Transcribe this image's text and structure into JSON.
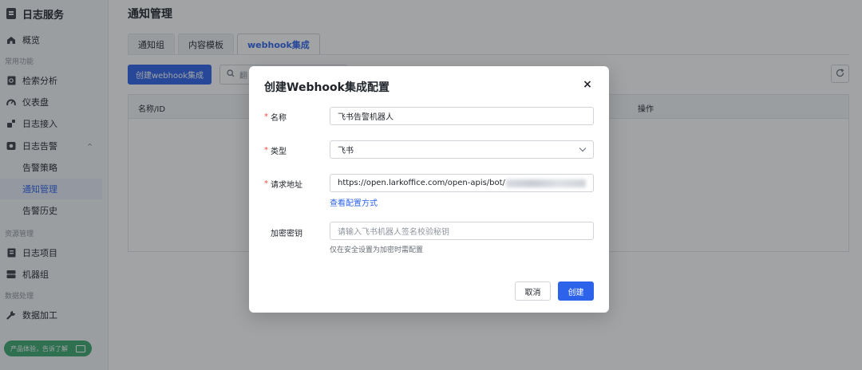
{
  "sidebar": {
    "brand": "日志服务",
    "overview": "概览",
    "section_common": "常用功能",
    "search_analysis": "检索分析",
    "dashboard": "仪表盘",
    "log_access": "日志接入",
    "log_alert": "日志告警",
    "alert_policy": "告警策略",
    "notify_manage": "通知管理",
    "alert_history": "告警历史",
    "section_resource": "资源管理",
    "log_project": "日志项目",
    "machine_group": "机器组",
    "section_data": "数据处理",
    "data_process": "数据加工",
    "feedback": "产品体验，告诉了解"
  },
  "main": {
    "title": "通知管理",
    "tabs": [
      "通知组",
      "内容模板",
      "webhook集成"
    ],
    "create_button": "创建webhook集成",
    "search_placeholder": "翻",
    "table_headers": {
      "name_id": "名称/ID",
      "actions": "操作"
    }
  },
  "modal": {
    "title": "创建Webhook集成配置",
    "close": "×",
    "name_label": "名称",
    "name_value": "飞书告警机器人",
    "type_label": "类型",
    "type_value": "飞书",
    "url_label": "请求地址",
    "url_value": "https://open.larkoffice.com/open-apis/bot/",
    "config_link": "查看配置方式",
    "secret_label": "加密密钥",
    "secret_placeholder": "请输入飞书机器人签名校验秘钥",
    "secret_hint": "仅在安全设置为加密时需配置",
    "cancel": "取消",
    "create": "创建"
  },
  "colors": {
    "primary": "#2d63ea",
    "required": "#f54a45",
    "feedback": "#3aa76d"
  }
}
